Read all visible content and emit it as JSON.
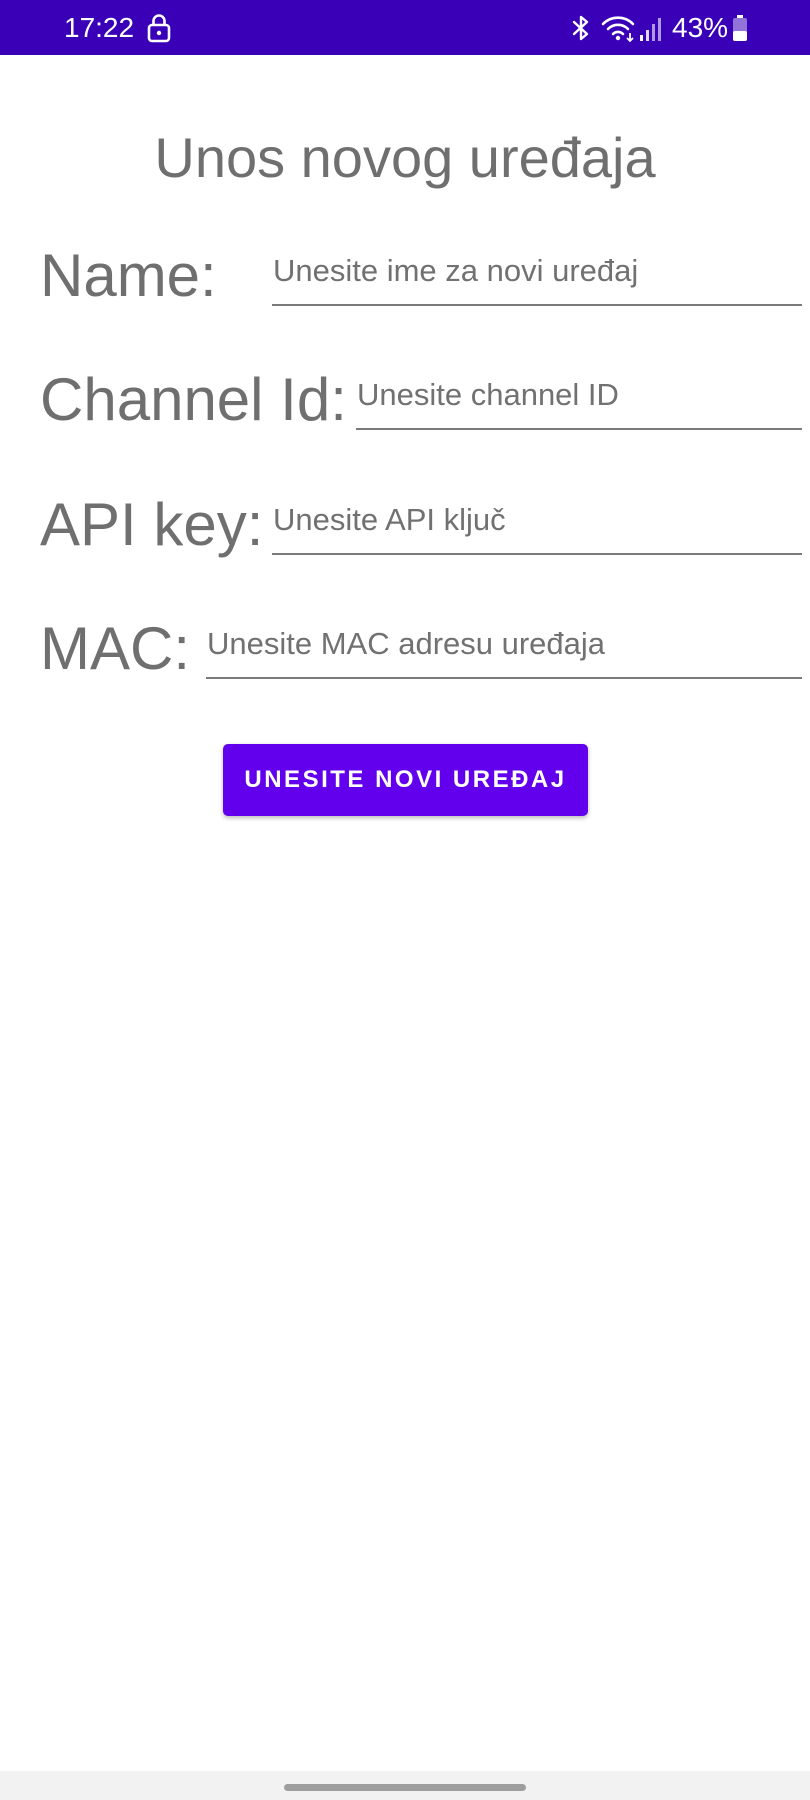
{
  "status_bar": {
    "time": "17:22",
    "lock_icon": "lock-icon",
    "bluetooth_icon": "bluetooth-icon",
    "wifi_icon": "wifi-icon",
    "signal_icon": "signal-icon",
    "battery_percent": "43%",
    "battery_level": 0.43,
    "background_color": "#3a00b8"
  },
  "page": {
    "title": "Unos novog uređaja"
  },
  "form": {
    "name": {
      "label": "Name:",
      "placeholder": "Unesite ime za novi uređaj"
    },
    "channel": {
      "label": "Channel Id:",
      "placeholder": "Unesite channel ID"
    },
    "api_key": {
      "label": "API key:",
      "placeholder": "Unesite API ključ"
    },
    "mac": {
      "label": "MAC:",
      "placeholder": "Unesite MAC adresu uređaja"
    }
  },
  "actions": {
    "submit_label": "UNESITE NOVI UREĐAJ",
    "accent_color": "#6200ee"
  }
}
